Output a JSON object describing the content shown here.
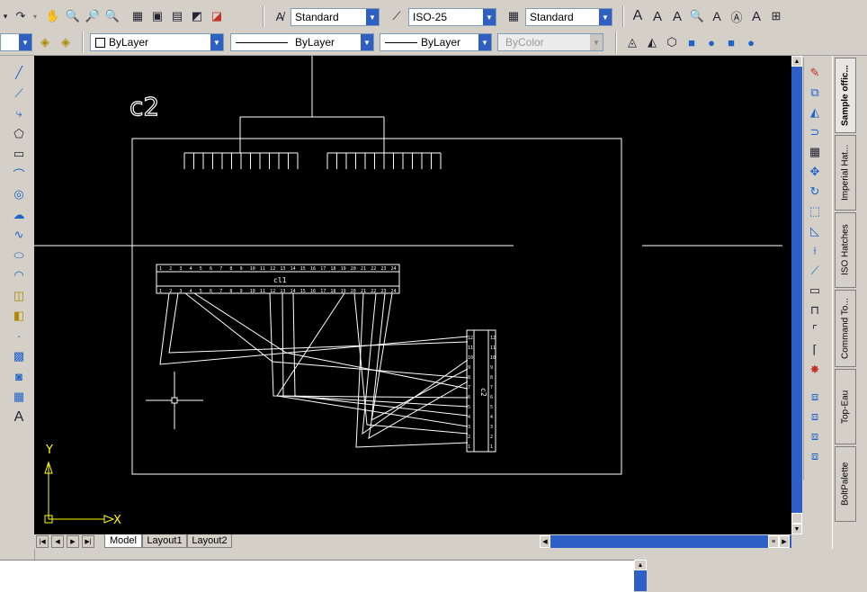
{
  "toolbar_top": {
    "text_style": "Standard",
    "dim_style": "ISO-25",
    "table_style": "Standard"
  },
  "properties_bar": {
    "color": "ByLayer",
    "linetype": "ByLayer",
    "lineweight": "ByLayer",
    "plot_style": "ByColor"
  },
  "drawing": {
    "block_label": "c2",
    "connector_top_label": "cl1",
    "connector_side_label": "c2"
  },
  "ucs": {
    "x_label": "X",
    "y_label": "Y"
  },
  "layout_tabs": [
    "Model",
    "Layout1",
    "Layout2"
  ],
  "palette_tabs": [
    "Sample offic...",
    "Imperial Hat...",
    "ISO Hatches",
    "Command To...",
    "Top-Eau",
    "BoltPalette"
  ],
  "colors": {
    "canvas": "#000000",
    "lines": "#ffffff",
    "scrollbar": "#2d5fc7",
    "chrome": "#d4d0c8"
  }
}
